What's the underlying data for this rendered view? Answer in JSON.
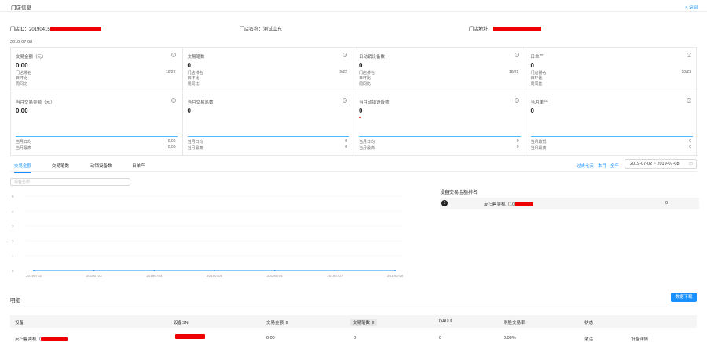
{
  "header": {
    "title": "门店信息",
    "back_label": "< 返回"
  },
  "store": {
    "id_label": "门店ID：20190415",
    "name_label": "门店名称：测试山东",
    "address_label": "门店地址："
  },
  "date": "2019-07-08",
  "metrics_row1": [
    {
      "label": "交易金额（元）",
      "value": "0.00",
      "rows": [
        {
          "k": "门店排名",
          "v": "18/22"
        },
        {
          "k": "日环比",
          "v": ""
        },
        {
          "k": "周同比",
          "v": ""
        }
      ]
    },
    {
      "label": "交易笔数",
      "value": "0",
      "rows": [
        {
          "k": "门店排名",
          "v": "9/22"
        },
        {
          "k": "日环比",
          "v": ""
        },
        {
          "k": "周同比",
          "v": ""
        }
      ]
    },
    {
      "label": "日动销设备数",
      "value": "0",
      "rows": [
        {
          "k": "门店排名",
          "v": "18/22"
        },
        {
          "k": "日环比",
          "v": ""
        },
        {
          "k": "周同比",
          "v": ""
        }
      ]
    },
    {
      "label": "日单产",
      "value": "0",
      "rows": [
        {
          "k": "门店排名",
          "v": "18/22"
        },
        {
          "k": "日环比",
          "v": ""
        },
        {
          "k": "周同比",
          "v": ""
        }
      ]
    }
  ],
  "metrics_row2": [
    {
      "label": "当月交易金额（元）",
      "value": "0.00",
      "rows": [
        {
          "k": "当月日均",
          "v": "0.00"
        },
        {
          "k": "当月最高",
          "v": "0.00"
        }
      ]
    },
    {
      "label": "当月交易笔数",
      "value": "0",
      "rows": [
        {
          "k": "当月日均",
          "v": "0"
        },
        {
          "k": "当月最高",
          "v": "0"
        }
      ]
    },
    {
      "label": "当月动销设备数",
      "value": "0",
      "rows": [
        {
          "k": "当月日均",
          "v": "0"
        },
        {
          "k": "当月最高",
          "v": "0"
        }
      ]
    },
    {
      "label": "当月单产",
      "value": "0",
      "rows": [
        {
          "k": "当月最低",
          "v": "0"
        },
        {
          "k": "当月最高",
          "v": "0"
        }
      ]
    }
  ],
  "tabs": [
    "交易金额",
    "交易笔数",
    "动销设备数",
    "日单产"
  ],
  "range_buttons": [
    "过去七天",
    "本月",
    "全年"
  ],
  "date_range": "2019-07-02  ~  2019-07-08",
  "search": {
    "placeholder": "设备名称"
  },
  "chart_data": {
    "type": "line",
    "categories": [
      "20190702",
      "20190703",
      "20190704",
      "20190705",
      "20190706",
      "20190707",
      "20190708"
    ],
    "series": [
      {
        "values": [
          0,
          0,
          0,
          0,
          0,
          0,
          0
        ]
      }
    ],
    "yticks": [
      "5",
      "4",
      "3",
      "2",
      "1",
      "0"
    ],
    "ylim": [
      0,
      5
    ],
    "color": "#1890ff"
  },
  "ranking": {
    "title": "设备交易金额排名",
    "items": [
      {
        "name": "反扫售卖机（10",
        "value": "0"
      }
    ]
  },
  "detail": {
    "title": "明细",
    "download_label": "数据下载",
    "columns": [
      "设备",
      "设备SN",
      "交易金额 ⇕",
      "交易笔数 ⇕",
      "DAU ⇕",
      "刷脸交易率",
      "状态"
    ],
    "rows": [
      {
        "device": "反扫售卖机（",
        "sn": "",
        "amount": "0.00",
        "count": "0",
        "dau": "0",
        "rate": "0.00%",
        "status": "激活",
        "action": "设备详情"
      }
    ]
  }
}
